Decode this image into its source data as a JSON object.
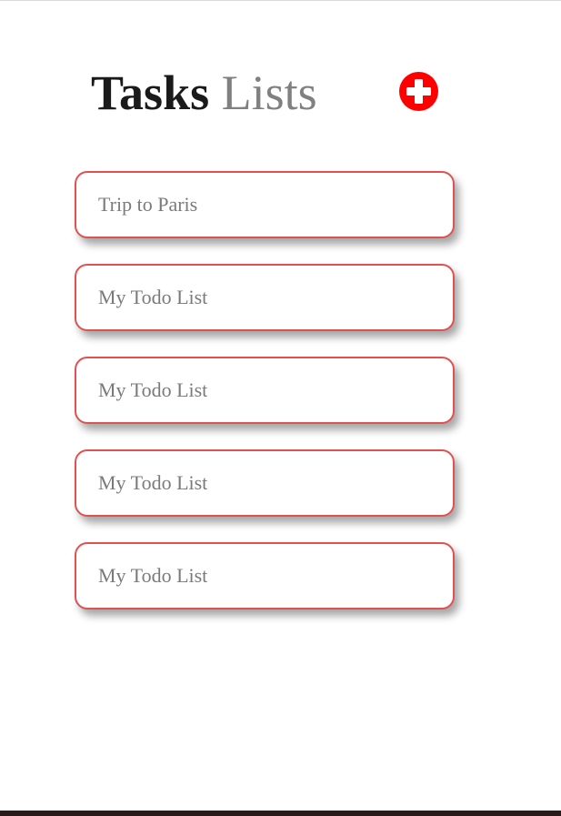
{
  "header": {
    "title_strong": "Tasks",
    "title_light": "Lists"
  },
  "add_button": {
    "icon": "plus-circle-icon",
    "color": "#ff0000"
  },
  "lists": [
    {
      "label": "Trip to Paris"
    },
    {
      "label": "My Todo List"
    },
    {
      "label": "My Todo List"
    },
    {
      "label": "My Todo List"
    },
    {
      "label": "My Todo List"
    }
  ],
  "colors": {
    "card_border": "#e05252",
    "accent": "#ff0000"
  }
}
